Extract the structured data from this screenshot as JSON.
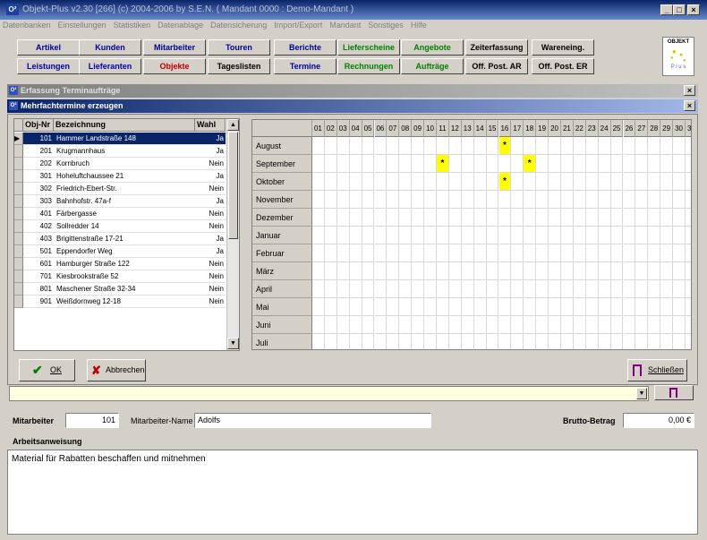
{
  "app": {
    "title": "Objekt-Plus  v2.30 [266]     (c) 2004-2006 by S.E.N.     ( Mandant 0000 : Demo-Mandant )",
    "logo_text": "O²",
    "controls": {
      "minimize": "_",
      "maximize": "□",
      "close": "×"
    }
  },
  "menu": [
    "Datenbanken",
    "Einstellungen",
    "Statistiken",
    "Datenablage",
    "Datensicherung",
    "Import/Export",
    "Mandant",
    "Sonstiges",
    "Hilfe"
  ],
  "toolbar": {
    "row1": [
      {
        "label": "Artikel",
        "color": "blue"
      },
      {
        "label": "Kunden",
        "color": "blue"
      },
      {
        "label": "Mitarbeiter",
        "color": "blue"
      },
      {
        "label": "Touren",
        "color": "blue"
      },
      {
        "label": "Berichte",
        "color": "blue"
      },
      {
        "label": "Lieferscheine",
        "color": "green"
      },
      {
        "label": "Angebote",
        "color": "green"
      },
      {
        "label": "Zeiterfassung",
        "color": "black"
      },
      {
        "label": "Wareneing.",
        "color": "black"
      }
    ],
    "row2": [
      {
        "label": "Leistungen",
        "color": "blue"
      },
      {
        "label": "Lieferanten",
        "color": "blue"
      },
      {
        "label": "Objekte",
        "color": "red"
      },
      {
        "label": "Tageslisten",
        "color": "black"
      },
      {
        "label": "Termine",
        "color": "blue"
      },
      {
        "label": "Rechnungen",
        "color": "green"
      },
      {
        "label": "Aufträge",
        "color": "green"
      },
      {
        "label": "Off. Post. AR",
        "color": "black"
      },
      {
        "label": "Off. Post. ER",
        "color": "black"
      }
    ],
    "logo_top": "OBJEKT",
    "logo_bottom": "P l u s"
  },
  "windows": {
    "outer_title": "Erfassung Terminaufträge",
    "inner_title": "Mehrfachtermine erzeugen",
    "close": "×"
  },
  "objects_table": {
    "headers": [
      "Obj-Nr",
      "Bezeichnung",
      "Wahl"
    ],
    "rows": [
      {
        "nr": "101",
        "name": "Hammer Landstraße 148",
        "wahl": "Ja",
        "selected": true
      },
      {
        "nr": "201",
        "name": "Krugmannhaus",
        "wahl": "Ja"
      },
      {
        "nr": "202",
        "name": "Kornbruch",
        "wahl": "Nein"
      },
      {
        "nr": "301",
        "name": "Hoheluftchaussee 21",
        "wahl": "Ja"
      },
      {
        "nr": "302",
        "name": "Friedrich-Ebert-Str.",
        "wahl": "Nein"
      },
      {
        "nr": "303",
        "name": "Bahnhofstr. 47a-f",
        "wahl": "Ja"
      },
      {
        "nr": "401",
        "name": "Färbergasse",
        "wahl": "Nein"
      },
      {
        "nr": "402",
        "name": "Sollredder 14",
        "wahl": "Nein"
      },
      {
        "nr": "403",
        "name": "Brigittenstraße 17-21",
        "wahl": "Ja"
      },
      {
        "nr": "501",
        "name": "Eppendorfer Weg",
        "wahl": "Ja"
      },
      {
        "nr": "601",
        "name": "Hamburger Straße 122",
        "wahl": "Nein"
      },
      {
        "nr": "701",
        "name": "Kiesbrookstraße 52",
        "wahl": "Nein"
      },
      {
        "nr": "801",
        "name": "Maschener Straße 32-34",
        "wahl": "Nein"
      },
      {
        "nr": "901",
        "name": "Weißdornweg 12-18",
        "wahl": "Nein"
      }
    ]
  },
  "calendar": {
    "days": [
      "01",
      "02",
      "03",
      "04",
      "05",
      "06",
      "07",
      "08",
      "09",
      "10",
      "11",
      "12",
      "13",
      "14",
      "15",
      "16",
      "17",
      "18",
      "19",
      "20",
      "21",
      "22",
      "23",
      "24",
      "25",
      "26",
      "27",
      "28",
      "29",
      "30",
      "31"
    ],
    "months": [
      "August",
      "September",
      "Oktober",
      "November",
      "Dezember",
      "Januar",
      "Februar",
      "März",
      "April",
      "Mai",
      "Juni",
      "Juli"
    ],
    "mark_symbol": "*",
    "marks": [
      {
        "month": "August",
        "day": 16
      },
      {
        "month": "September",
        "day": 11
      },
      {
        "month": "September",
        "day": 18
      },
      {
        "month": "Oktober",
        "day": 16
      }
    ]
  },
  "buttons": {
    "ok": "OK",
    "cancel": "Abbrechen",
    "close": "Schließen"
  },
  "form": {
    "mitarbeiter_label": "Mitarbeiter",
    "mitarbeiter_value": "101",
    "name_label": "Mitarbeiter-Name",
    "name_value": "Adolfs",
    "brutto_label": "Brutto-Betrag",
    "brutto_value": "0,00 €",
    "anweisung_label": "Arbeitsanweisung",
    "anweisung_text": "Material für Rabatten beschaffen und mitnehmen"
  }
}
